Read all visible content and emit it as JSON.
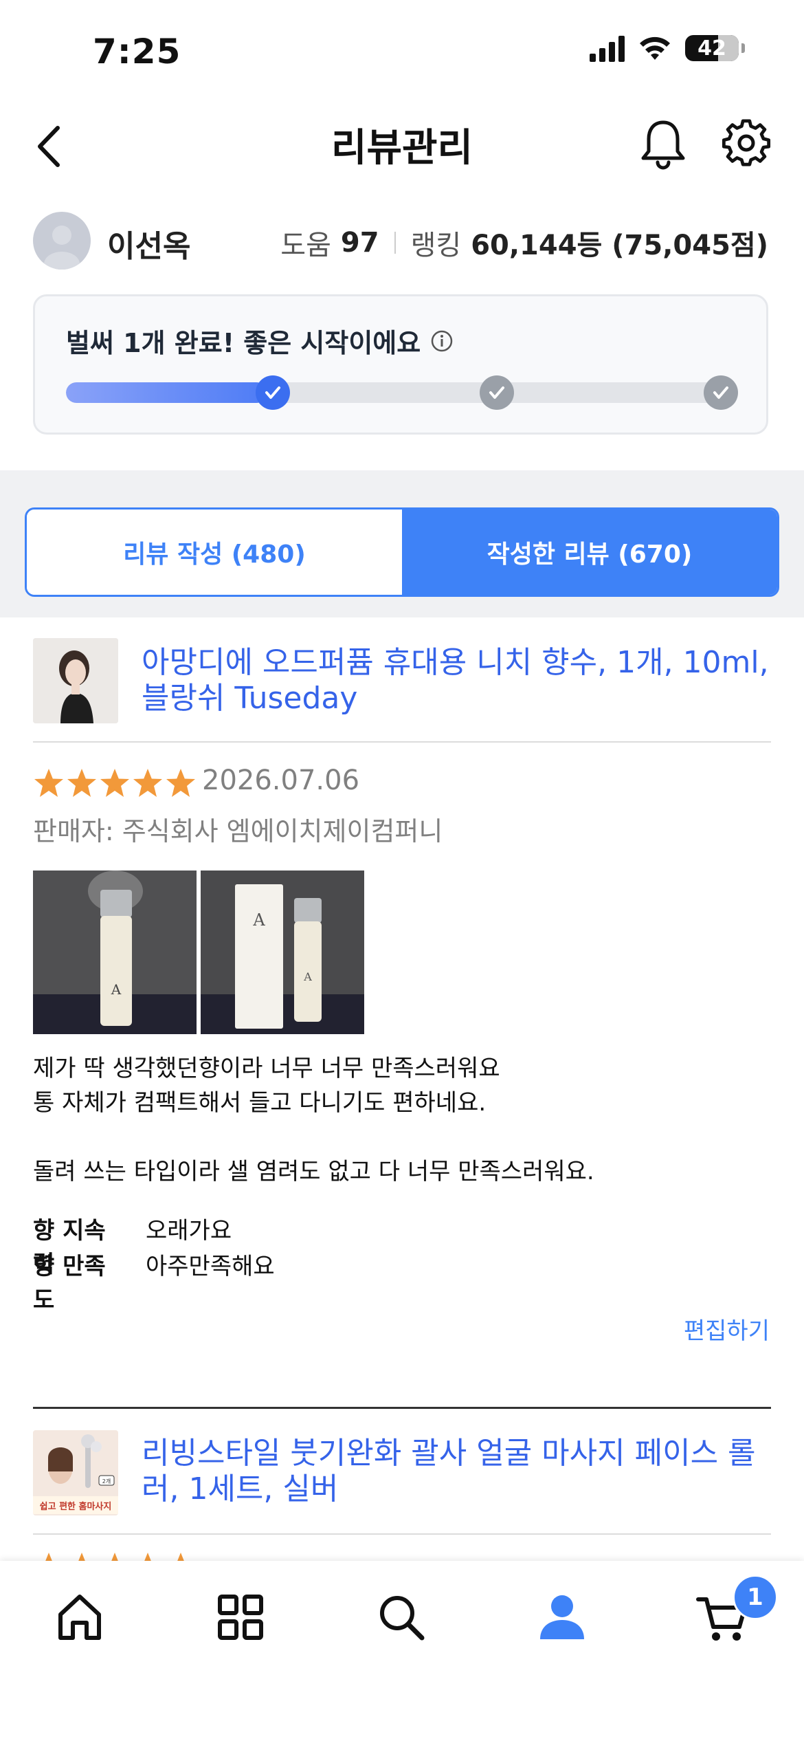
{
  "status_bar": {
    "time": "7:25",
    "battery": "42"
  },
  "header": {
    "title": "리뷰관리"
  },
  "profile": {
    "name": "이선옥",
    "help_label": "도움",
    "help_value": "97",
    "ranking_label": "랭킹",
    "ranking_value": "60,144등 (75,045점)"
  },
  "progress": {
    "message": "벌써 1개 완료! 좋은 시작이에요",
    "completed_steps": 1,
    "total_steps": 3,
    "fill_fraction": 0.3
  },
  "tabs": [
    {
      "label": "리뷰 작성 (480)",
      "active": false
    },
    {
      "label": "작성한 리뷰 (670)",
      "active": true
    }
  ],
  "reviews": [
    {
      "product_title": "아망디에 오드퍼퓸 휴대용 니치 향수, 1개, 10ml, 블랑쉬 Tuseday",
      "rating": 5,
      "date": "2026.07.06",
      "seller": "판매자: 주식회사 엠에이치제이컴퍼니",
      "text_lines": [
        "제가 딱 생각했던향이라 너무 너무 만족스러워요",
        "통 자체가 컴팩트해서 들고 다니기도 편하네요.",
        "",
        "돌려 쓰는 타입이라 샐 염려도 없고 다 너무 만족스러워요."
      ],
      "attributes": [
        {
          "key": "향 지속력",
          "value": "오래가요"
        },
        {
          "key": "향 만족도",
          "value": "아주만족해요"
        }
      ],
      "edit_label": "편집하기"
    },
    {
      "product_title": "리빙스타일 붓기완화 괄사 얼굴 마사지 페이스 롤러, 1세트, 실버",
      "thumb_text": "쉽고 편한 홈마사지",
      "thumb_badge": "2개"
    }
  ],
  "bottom_nav": {
    "items": [
      "home-icon",
      "categories-icon",
      "search-icon",
      "my-page-icon",
      "cart-icon"
    ],
    "cart_badge": "1",
    "active": "my-page-icon",
    "accent": "#3e82f7"
  }
}
